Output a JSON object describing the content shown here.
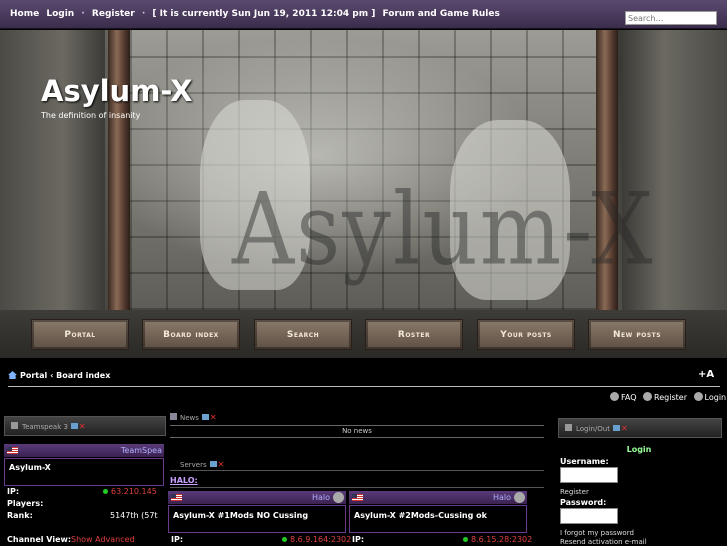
{
  "topbar": {
    "home": "Home",
    "login": "Login",
    "register": "Register",
    "datetime": "[ It is currently Sun Jun 19, 2011 12:04 pm ]",
    "rules": "Forum and Game Rules",
    "search_placeholder": "Search…"
  },
  "header": {
    "title": "Asylum-X",
    "tagline": "The definition of insanity",
    "watermark": "Asylum-X"
  },
  "nav": [
    "Portal",
    "Board index",
    "Search",
    "Roster",
    "Your posts",
    "New posts"
  ],
  "breadcrumb": {
    "portal": "Portal",
    "separator": "‹",
    "board_index": "Board index"
  },
  "font_size_label": "+A",
  "userlinks": {
    "faq": "FAQ",
    "register": "Register",
    "login": "Login"
  },
  "teamspeak": {
    "header": "Teamspeak 3",
    "bar_label": "TeamSpea",
    "server": "Asylum-X",
    "ip_label": "IP:",
    "ip": "63.210.145",
    "players_label": "Players:",
    "rank_label": "Rank:",
    "rank": "5147th (57t",
    "channel_view_label": "Channel View:",
    "show_advanced": "Show Advanced"
  },
  "news": {
    "header": "News",
    "empty": "No news"
  },
  "servers": {
    "header": "Servers",
    "game": "HALO:",
    "items": [
      {
        "bar_label": "Halo",
        "name": "Asylum-X #1Mods NO Cussing",
        "ip_label": "IP:",
        "ip": "8.6.9.164:2302"
      },
      {
        "bar_label": "Halo",
        "name": "Asylum-X #2Mods-Cussing ok",
        "ip_label": "IP:",
        "ip": "8.6.15.28:2302"
      }
    ]
  },
  "login": {
    "header": "Login/Out",
    "title": "Login",
    "username_label": "Username:",
    "register": "Register",
    "password_label": "Password:",
    "forgot": "I forgot my password",
    "resend": "Resend activation e-mail"
  }
}
